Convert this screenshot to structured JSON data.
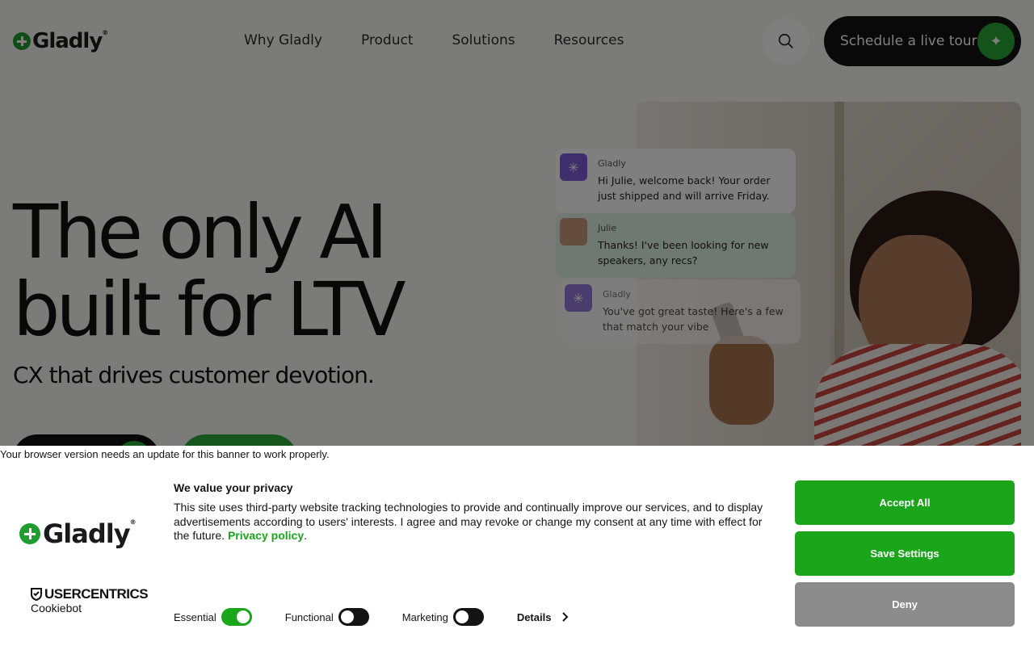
{
  "nav": {
    "logo": "Gladly",
    "logo_reg": "®",
    "menu": [
      "Why Gladly",
      "Product",
      "Solutions",
      "Resources"
    ],
    "cta": "Schedule a live tour"
  },
  "hero": {
    "title_line1": "The only AI",
    "title_line2": "built for LTV",
    "subtitle": "CX that drives customer devotion."
  },
  "chat": [
    {
      "name": "Gladly",
      "message": "Hi Julie, welcome back! Your order just shipped and will arrive Friday."
    },
    {
      "name": "Julie",
      "message": "Thanks! I've been looking for new speakers, any recs?"
    },
    {
      "name": "Gladly",
      "message": "You've got great taste! Here's a few that match your vibe"
    }
  ],
  "banner": {
    "update_notice": "Your browser version needs an update for this banner to work properly.",
    "logo": "Gladly",
    "logo_reg": "®",
    "cookiebot_brand": "USERCENTRICS",
    "cookiebot_product": "Cookiebot",
    "title": "We value your privacy",
    "text": "This site uses third-party website tracking technologies to provide and continually improve our services, and to display advertisements according to users' interests. I agree and may revoke or change my consent at any time with effect for the future.",
    "privacy_link": "Privacy policy",
    "toggles": [
      {
        "label": "Essential",
        "on": true
      },
      {
        "label": "Functional",
        "on": false
      },
      {
        "label": "Marketing",
        "on": false
      }
    ],
    "details": "Details",
    "accept_all": "Accept All",
    "save_settings": "Save Settings",
    "deny": "Deny"
  },
  "colors": {
    "accent_green": "#1aa51a",
    "deny_gray": "#8c8c8c",
    "dark_button": "#121212"
  }
}
